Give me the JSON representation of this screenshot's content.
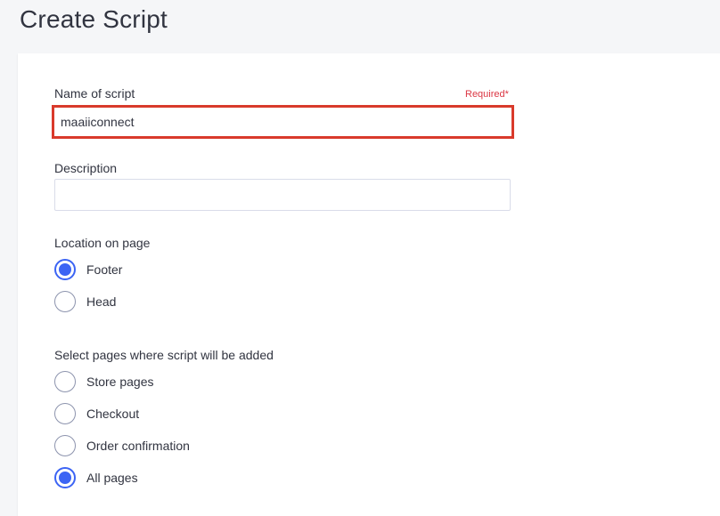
{
  "page": {
    "title": "Create Script"
  },
  "form": {
    "name": {
      "label": "Name of script",
      "required_label": "Required*",
      "value": "maaiiconnect"
    },
    "description": {
      "label": "Description",
      "value": ""
    },
    "location": {
      "label": "Location on page",
      "options": [
        {
          "label": "Footer",
          "checked": true
        },
        {
          "label": "Head",
          "checked": false
        }
      ]
    },
    "pages": {
      "label": "Select pages where script will be added",
      "options": [
        {
          "label": "Store pages",
          "checked": false
        },
        {
          "label": "Checkout",
          "checked": false
        },
        {
          "label": "Order confirmation",
          "checked": false
        },
        {
          "label": "All pages",
          "checked": true
        }
      ]
    }
  },
  "colors": {
    "accent": "#3c64f4",
    "required": "#db3643",
    "highlight_border": "#d93a2b",
    "text": "#313440"
  }
}
